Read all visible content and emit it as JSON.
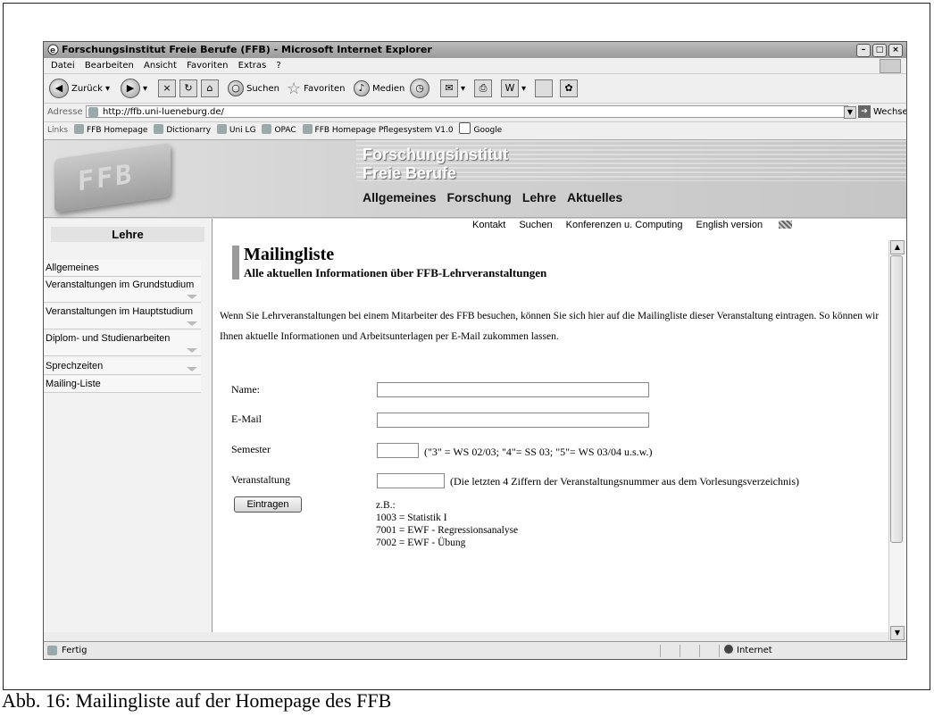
{
  "window": {
    "title": "Forschungsinstitut Freie Berufe (FFB) - Microsoft Internet Explorer"
  },
  "menu": [
    "Datei",
    "Bearbeiten",
    "Ansicht",
    "Favoriten",
    "Extras",
    "?"
  ],
  "toolbar": {
    "back": "Zurück",
    "search": "Suchen",
    "favorites": "Favoriten",
    "media": "Medien"
  },
  "address": {
    "label": "Adresse",
    "url": "http://ffb.uni-lueneburg.de/",
    "go": "Wechseln zu"
  },
  "links": {
    "label": "Links",
    "items": [
      "FFB Homepage",
      "Dictionarry",
      "Uni LG",
      "OPAC",
      "FFB Homepage Pflegesystem V1.0",
      "Google"
    ]
  },
  "banner": {
    "title_line1": "Forschungsinstitut",
    "title_line2": "Freie Berufe",
    "logo": "FFB"
  },
  "mainnav": [
    "Allgemeines",
    "Forschung",
    "Lehre",
    "Aktuelles"
  ],
  "subnav": [
    "Kontakt",
    "Suchen",
    "Konferenzen u. Computing",
    "English version"
  ],
  "sidebar": {
    "heading": "Lehre",
    "items": [
      "Allgemeines",
      "Veranstaltungen im Grundstudium",
      "Veranstaltungen im Hauptstudium",
      "Diplom- und Studienarbeiten",
      "Sprechzeiten",
      "Mailing-Liste"
    ]
  },
  "page": {
    "title": "Mailingliste",
    "subtitle": "Alle aktuellen Informationen über FFB-Lehrveranstaltungen",
    "intro": "Wenn Sie Lehrveranstaltungen bei einem Mitarbeiter des FFB besuchen, können Sie sich hier auf die Mailingliste dieser Veranstaltung eintragen. So können wir Ihnen aktuelle Informationen und Arbeitsunterlagen per E-Mail zukommen lassen."
  },
  "form": {
    "name_label": "Name:",
    "name_value": "",
    "email_label": "E-Mail",
    "email_value": "",
    "semester_label": "Semester",
    "semester_value": "",
    "semester_hint": "(\"3\" = WS 02/03; \"4\"= SS 03; \"5\"= WS 03/04 u.s.w.)",
    "course_label": "Veranstaltung",
    "course_value": "",
    "course_hint": "(Die letzten 4 Ziffern der Veranstaltungsnummer aus dem Vorlesungsverzeichnis)",
    "submit": "Eintragen",
    "examples": [
      "z.B.:",
      "1003 = Statistik I",
      "7001 = EWF - Regressionsanalyse",
      "7002 = EWF - Übung"
    ]
  },
  "status": {
    "text": "Fertig",
    "zone": "Internet"
  },
  "caption": "Abb. 16: Mailingliste auf der Homepage des FFB"
}
